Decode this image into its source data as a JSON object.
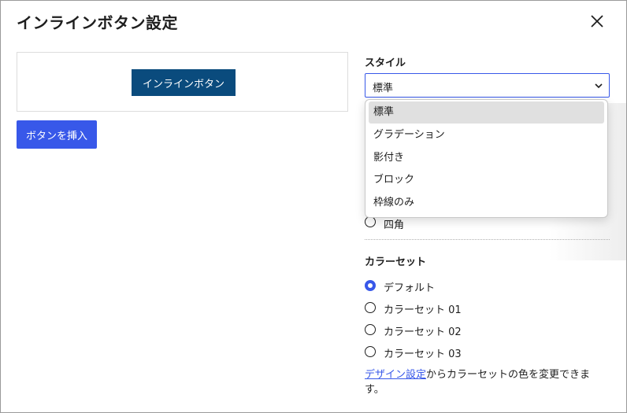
{
  "dialog": {
    "title": "インラインボタン設定",
    "close_icon": "close-icon"
  },
  "preview": {
    "button_label": "インラインボタン",
    "button_color": "#0a4b7d"
  },
  "insert_button": {
    "label": "ボタンを挿入",
    "color": "#3858e9"
  },
  "style": {
    "label": "スタイル",
    "selected": "標準",
    "options": [
      "標準",
      "グラデーション",
      "影付き",
      "ブロック",
      "枠線のみ"
    ]
  },
  "shape": {
    "options": [
      {
        "label": "四角",
        "checked": false
      }
    ]
  },
  "color_set": {
    "label": "カラーセット",
    "options": [
      {
        "label": "デフォルト",
        "checked": true
      },
      {
        "label": "カラーセット 01",
        "checked": false
      },
      {
        "label": "カラーセット 02",
        "checked": false
      },
      {
        "label": "カラーセット 03",
        "checked": false
      }
    ],
    "help_link": "デザイン設定",
    "help_text": "からカラーセットの色を変更できます。"
  },
  "colors": {
    "accent": "#3858e9",
    "text": "#1e1e1e"
  }
}
